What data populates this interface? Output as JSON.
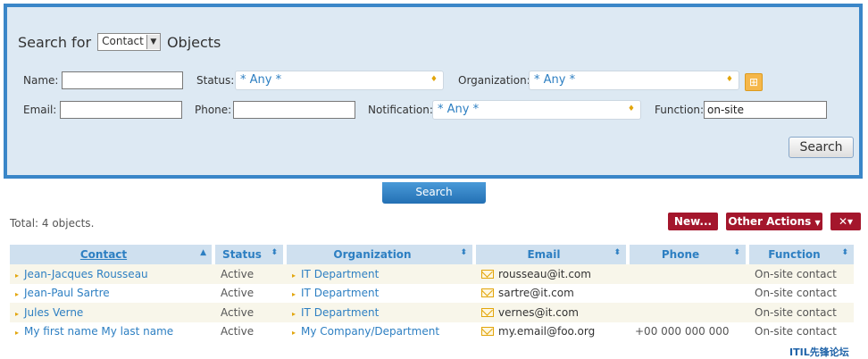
{
  "search": {
    "title_prefix": "Search for",
    "object_type": "Contact",
    "title_suffix": "Objects",
    "fields": {
      "name_label": "Name:",
      "name_value": "",
      "status_label": "Status:",
      "status_value": "* Any *",
      "organization_label": "Organization:",
      "organization_value": "* Any *",
      "email_label": "Email:",
      "email_value": "",
      "phone_label": "Phone:",
      "phone_value": "",
      "notification_label": "Notification:",
      "notification_value": "* Any *",
      "function_label": "Function:",
      "function_value": "on-site"
    },
    "search_button": "Search"
  },
  "tabs": {
    "search_tab": "Search"
  },
  "results": {
    "total": "Total: 4 objects.",
    "new_button": "New...",
    "other_actions_button": "Other Actions",
    "tools_button": "tools-icon",
    "columns": [
      "Contact",
      "Status",
      "Organization",
      "Email",
      "Phone",
      "Function"
    ],
    "rows": [
      {
        "contact": "Jean-Jacques Rousseau",
        "status": "Active",
        "organization": "IT Department",
        "email": "rousseau@it.com",
        "phone": "",
        "function": "On-site contact"
      },
      {
        "contact": "Jean-Paul Sartre",
        "status": "Active",
        "organization": "IT Department",
        "email": "sartre@it.com",
        "phone": "",
        "function": "On-site contact"
      },
      {
        "contact": "Jules Verne",
        "status": "Active",
        "organization": "IT Department",
        "email": "vernes@it.com",
        "phone": "",
        "function": "On-site contact"
      },
      {
        "contact": "My first name My last name",
        "status": "Active",
        "organization": "My Company/Department",
        "email": "my.email@foo.org",
        "phone": "+00 000 000 000",
        "function": "On-site contact"
      }
    ]
  },
  "watermark": "ITIL先锋论坛",
  "colors": {
    "panel_border": "#3a86c8",
    "panel_bg": "#dde9f3",
    "action_red": "#a4162c",
    "link_blue": "#2d7fc2"
  }
}
